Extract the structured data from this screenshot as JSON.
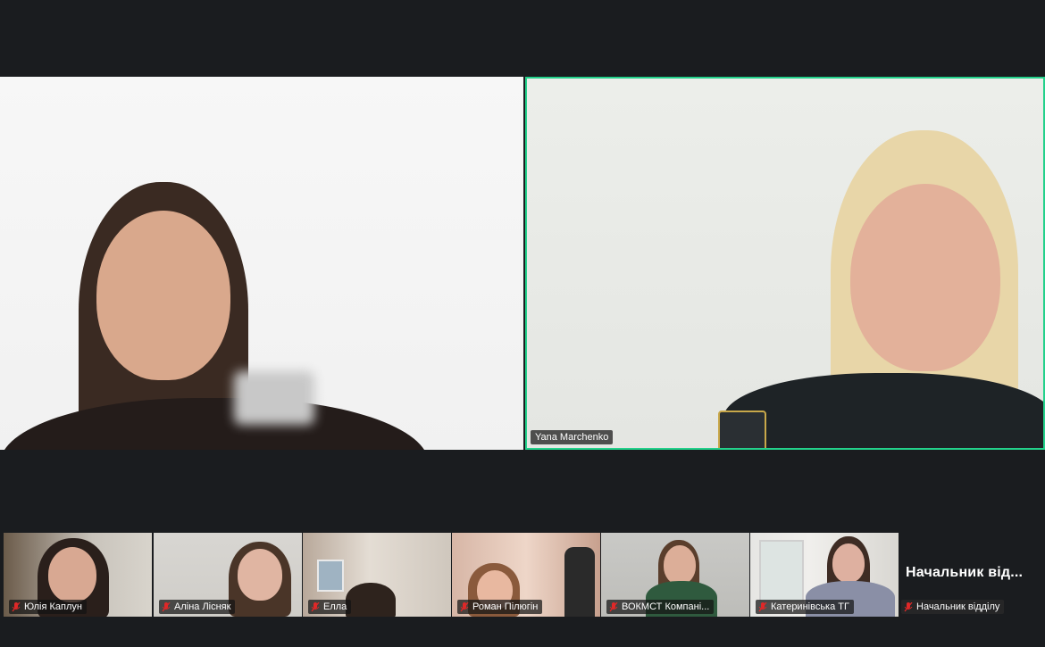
{
  "meeting": {
    "speakers": [
      {
        "id": "left",
        "name": ""
      },
      {
        "id": "right",
        "name": "Yana Marchenko"
      }
    ],
    "gallery": [
      {
        "name": "Юлія Каплун",
        "muted": true
      },
      {
        "name": "Аліна Лісняк",
        "muted": true
      },
      {
        "name": "Елла",
        "muted": true
      },
      {
        "name": "Роман Пілюгін",
        "muted": true
      },
      {
        "name": "ВОКМСТ Компані...",
        "muted": true
      },
      {
        "name": "Катеринівська ТГ",
        "muted": true
      },
      {
        "name": "Начальник відділу",
        "muted": true,
        "display_name": "Начальник від...",
        "video": false
      }
    ],
    "colors": {
      "active_speaker_border": "#23d18b",
      "background": "#1a1c1f",
      "muted_icon": "#e02828"
    },
    "icons": {
      "muted": "mic-off-icon"
    }
  }
}
